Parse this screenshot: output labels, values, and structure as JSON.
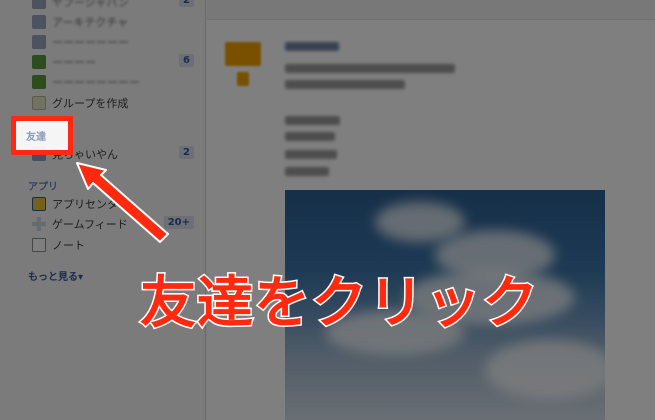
{
  "sidebar": {
    "groups": [
      {
        "label": "ヤフージャパン",
        "blurred": true,
        "count": "2"
      },
      {
        "label": "アーキテクチャ",
        "blurred": true,
        "count": ""
      },
      {
        "label": "ーーーーーーー",
        "blurred": true,
        "count": ""
      },
      {
        "label": "ーーーー",
        "blurred": true,
        "count": "6"
      },
      {
        "label": "ーーーーーーーー",
        "blurred": true,
        "count": ""
      }
    ],
    "create_group": "グループを作成",
    "friends_header": "友達",
    "friend_item": {
      "label": "見ちゃいやん",
      "count": "2"
    },
    "apps_header": "アプリ",
    "apps": [
      {
        "label": "アプリセンター",
        "count": ""
      },
      {
        "label": "ゲームフィード",
        "count": "20+"
      },
      {
        "label": "ノート",
        "count": ""
      }
    ],
    "more": "もっと見る▾"
  },
  "annotation": {
    "caption": "友達をクリック",
    "highlight_color": "#ff2a0f"
  }
}
